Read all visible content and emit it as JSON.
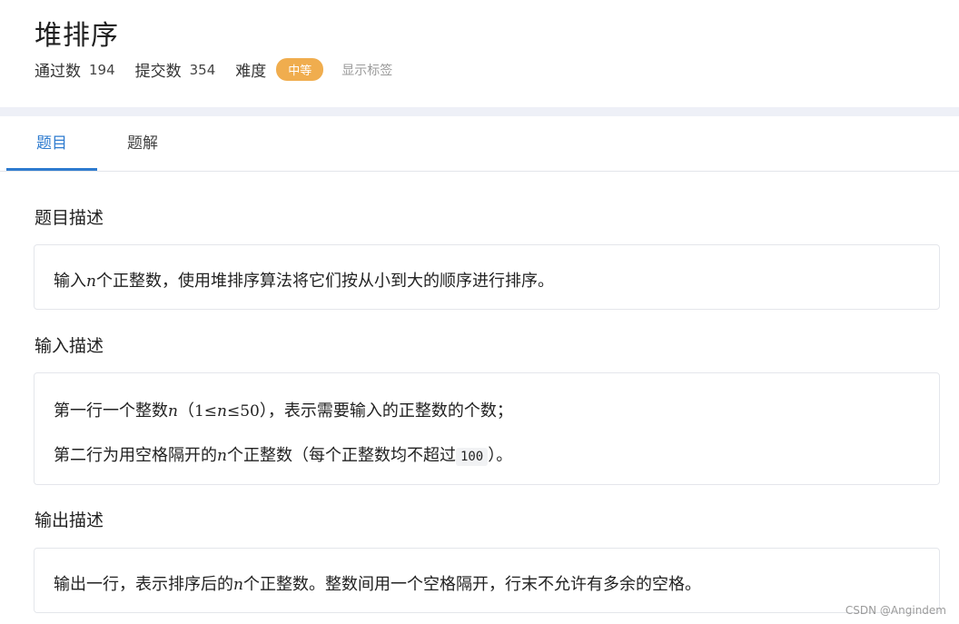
{
  "problem": {
    "title": "堆排序",
    "pass_label": "通过数",
    "pass_count": "194",
    "submit_label": "提交数",
    "submit_count": "354",
    "difficulty_label": "难度",
    "difficulty": "中等",
    "show_tags": "显示标签"
  },
  "tabs": [
    {
      "label": "题目",
      "active": true
    },
    {
      "label": "题解",
      "active": false
    }
  ],
  "sections": {
    "description": {
      "heading": "题目描述",
      "line1": {
        "a": "输入",
        "var": "n",
        "b": "个正整数，使用堆排序算法将它们按从小到大的顺序进行排序。"
      }
    },
    "input": {
      "heading": "输入描述",
      "line1": {
        "a": "第一行一个整数",
        "var": "n",
        "b": "（",
        "c": "1",
        "le1": "≤",
        "var2": "n",
        "le2": "≤",
        "d": "50",
        "e": "），表示需要输入的正整数的个数；"
      },
      "line2": {
        "a": "第二行为用空格隔开的",
        "var": "n",
        "b": "个正整数（每个正整数均不超过",
        "code": "100",
        "c": "）。"
      }
    },
    "output": {
      "heading": "输出描述",
      "line1": {
        "a": "输出一行，表示排序后的",
        "var": "n",
        "b": "个正整数。整数间用一个空格隔开，行末不允许有多余的空格。"
      }
    }
  },
  "watermark": "CSDN @Angindem",
  "colors": {
    "accent": "#2e7bcf",
    "badge": "#f0ad4e",
    "separator": "#eef0f7"
  }
}
